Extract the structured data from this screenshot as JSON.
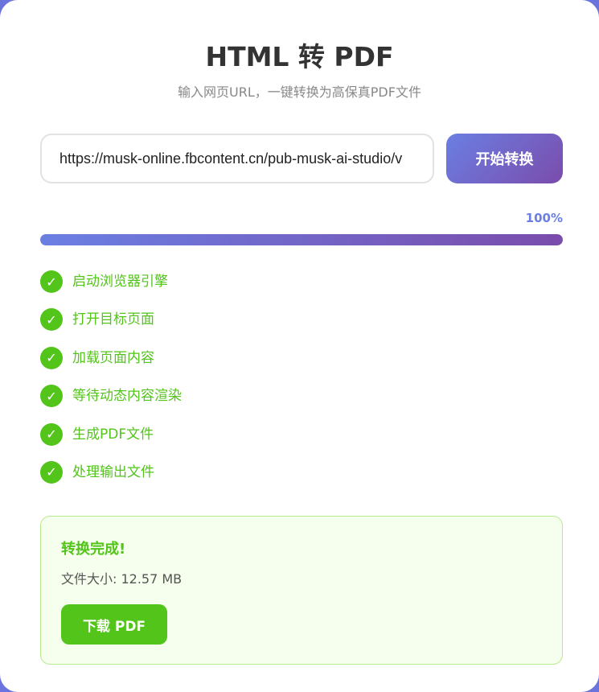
{
  "header": {
    "title": "HTML 转 PDF",
    "subtitle": "输入网页URL，一键转换为高保真PDF文件"
  },
  "form": {
    "url_value": "https://musk-online.fbcontent.cn/pub-musk-ai-studio/v",
    "convert_label": "开始转换"
  },
  "progress": {
    "percent_label": "100%",
    "value": 1.0
  },
  "steps": [
    {
      "label": "启动浏览器引擎",
      "status": "done"
    },
    {
      "label": "打开目标页面",
      "status": "done"
    },
    {
      "label": "加载页面内容",
      "status": "done"
    },
    {
      "label": "等待动态内容渲染",
      "status": "done"
    },
    {
      "label": "生成PDF文件",
      "status": "done"
    },
    {
      "label": "处理输出文件",
      "status": "done"
    }
  ],
  "result": {
    "title": "转换完成!",
    "file_size": "文件大小: 12.57 MB",
    "download_label": "下载 PDF"
  },
  "colors": {
    "accent_start": "#6b7fe3",
    "accent_end": "#7a4cab",
    "success": "#52c41a",
    "success_bg": "#f6ffed"
  }
}
